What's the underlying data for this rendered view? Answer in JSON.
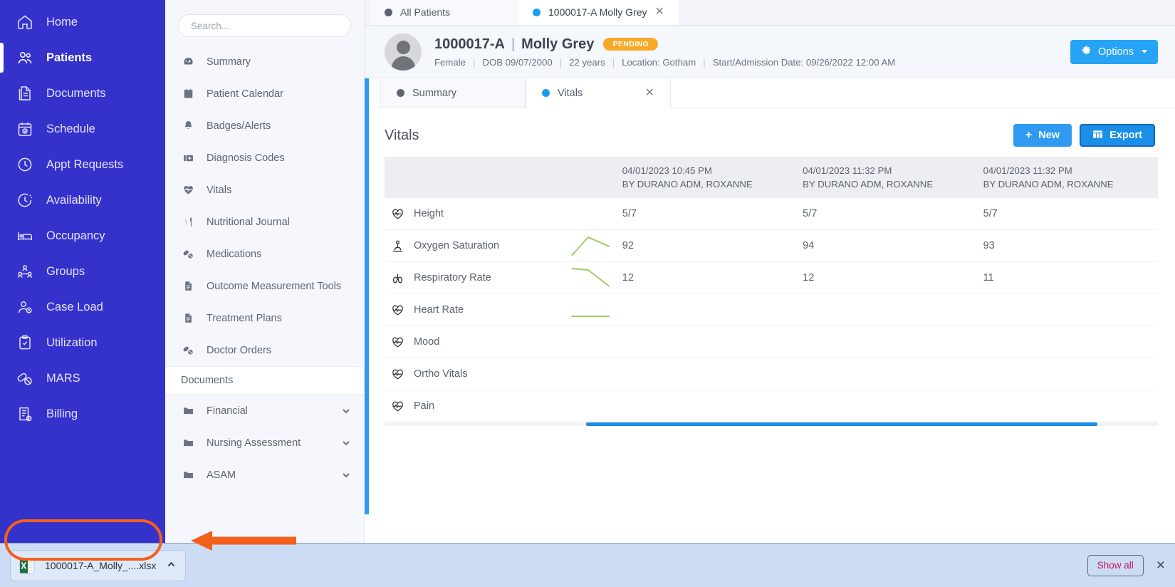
{
  "sidebar": {
    "items": [
      {
        "label": "Home",
        "icon": "home-icon",
        "active": false
      },
      {
        "label": "Patients",
        "icon": "patients-icon",
        "active": true
      },
      {
        "label": "Documents",
        "icon": "documents-icon",
        "active": false
      },
      {
        "label": "Schedule",
        "icon": "schedule-icon",
        "active": false
      },
      {
        "label": "Appt Requests",
        "icon": "clock-icon",
        "active": false
      },
      {
        "label": "Availability",
        "icon": "availability-icon",
        "active": false
      },
      {
        "label": "Occupancy",
        "icon": "bed-icon",
        "active": false
      },
      {
        "label": "Groups",
        "icon": "groups-icon",
        "active": false
      },
      {
        "label": "Case Load",
        "icon": "case-load-icon",
        "active": false
      },
      {
        "label": "Utilization",
        "icon": "clipboard-check-icon",
        "active": false
      },
      {
        "label": "MARS",
        "icon": "pills-icon",
        "active": false
      },
      {
        "label": "Billing",
        "icon": "billing-icon",
        "active": false
      }
    ]
  },
  "secondary": {
    "search_placeholder": "Search...",
    "items": [
      {
        "label": "Summary",
        "icon": "gauge-icon"
      },
      {
        "label": "Patient Calendar",
        "icon": "calendar-icon"
      },
      {
        "label": "Badges/Alerts",
        "icon": "bell-icon"
      },
      {
        "label": "Diagnosis Codes",
        "icon": "medkit-icon"
      },
      {
        "label": "Vitals",
        "icon": "heartbeat-icon"
      },
      {
        "label": "Nutritional Journal",
        "icon": "utensils-icon"
      },
      {
        "label": "Medications",
        "icon": "pills-icon"
      },
      {
        "label": "Outcome Measurement Tools",
        "icon": "file-icon"
      },
      {
        "label": "Treatment Plans",
        "icon": "file-icon"
      },
      {
        "label": "Doctor Orders",
        "icon": "pills-icon"
      }
    ],
    "section_label": "Documents",
    "folders": [
      {
        "label": "Financial",
        "icon": "folder-icon"
      },
      {
        "label": "Nursing Assessment",
        "icon": "folder-icon"
      },
      {
        "label": "ASAM",
        "icon": "folder-icon"
      }
    ]
  },
  "browser_tabs": [
    {
      "label": "All Patients",
      "active": false,
      "dot": "gray",
      "closable": false
    },
    {
      "label": "1000017-A Molly Grey",
      "active": true,
      "dot": "blue",
      "closable": true
    }
  ],
  "patient": {
    "id": "1000017-A",
    "separator": "|",
    "name": "Molly Grey",
    "status_badge": "PENDING",
    "gender": "Female",
    "dob": "DOB 09/07/2000",
    "age": "22 years",
    "location": "Location: Gotham",
    "admission": "Start/Admission Date: 09/26/2022 12:00 AM",
    "options_button": "Options"
  },
  "inner_tabs": [
    {
      "label": "Summary",
      "active": false,
      "dot": "gray",
      "closable": false
    },
    {
      "label": "Vitals",
      "active": true,
      "dot": "blue",
      "closable": true
    }
  ],
  "panel": {
    "title": "Vitals",
    "new_button": "New",
    "export_button": "Export"
  },
  "chart_data": {
    "type": "table",
    "title": "Vitals",
    "columns": [
      {
        "date": "04/01/2023 10:45 PM",
        "by": "BY DURANO ADM, ROXANNE"
      },
      {
        "date": "04/01/2023 11:32 PM",
        "by": "BY DURANO ADM, ROXANNE"
      },
      {
        "date": "04/01/2023 11:32 PM",
        "by": "BY DURANO ADM, ROXANNE"
      }
    ],
    "rows": [
      {
        "label": "Height",
        "icon": "heartbeat-icon",
        "spark": [],
        "values": [
          "5/7",
          "5/7",
          "5/7"
        ]
      },
      {
        "label": "Oxygen Saturation",
        "icon": "lungs-person-icon",
        "spark": [
          92,
          97,
          94
        ],
        "values": [
          "92",
          "94",
          "93"
        ]
      },
      {
        "label": "Respiratory Rate",
        "icon": "lungs-icon",
        "spark": [
          14,
          14,
          10
        ],
        "values": [
          "12",
          "12",
          "11"
        ]
      },
      {
        "label": "Heart Rate",
        "icon": "heartbeat-icon",
        "spark": [
          60,
          60,
          60
        ],
        "values": [
          "",
          "",
          ""
        ]
      },
      {
        "label": "Mood",
        "icon": "heartbeat-icon",
        "spark": [],
        "values": [
          "",
          "",
          ""
        ]
      },
      {
        "label": "Ortho Vitals",
        "icon": "heartbeat-icon",
        "spark": [],
        "values": [
          "",
          "",
          ""
        ]
      },
      {
        "label": "Pain",
        "icon": "heartbeat-icon",
        "spark": [],
        "values": [
          "",
          "",
          ""
        ]
      }
    ],
    "spark_color": "#9ccc65",
    "legend": [],
    "grid": false
  },
  "download_bar": {
    "file_name": "1000017-A_Molly_....xlsx",
    "show_all": "Show all",
    "close": "×"
  },
  "colors": {
    "sidebar": "#3532cc",
    "accent": "#2e9bf0",
    "badge": "#f9a825",
    "spark": "#9ccc65",
    "annotation": "#f4601a"
  }
}
